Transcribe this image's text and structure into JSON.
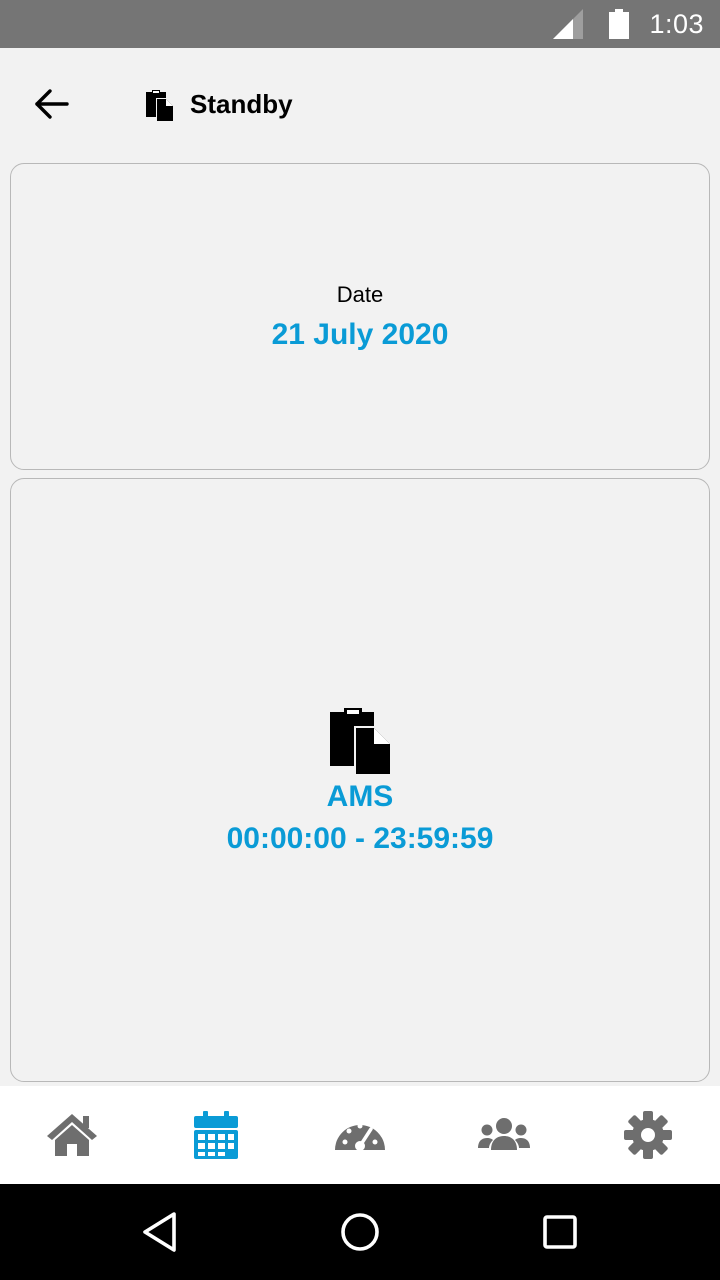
{
  "status_bar": {
    "time": "1:03"
  },
  "header": {
    "title": "Standby",
    "back_icon": "arrow-left-icon",
    "title_icon": "clipboard-icon"
  },
  "date_card": {
    "label": "Date",
    "value": "21 July 2020"
  },
  "duty_card": {
    "icon": "clipboard-icon",
    "code": "AMS",
    "time_range": "00:00:00 - 23:59:59"
  },
  "bottom_nav": {
    "items": [
      {
        "icon": "home-icon",
        "active": false
      },
      {
        "icon": "calendar-icon",
        "active": true
      },
      {
        "icon": "speedometer-icon",
        "active": false
      },
      {
        "icon": "users-icon",
        "active": false
      },
      {
        "icon": "settings-icon",
        "active": false
      }
    ]
  },
  "colors": {
    "accent": "#0a9bd6",
    "inactive_icon": "#6e6e6e",
    "background": "#f2f2f2",
    "status_bar": "#757575"
  }
}
